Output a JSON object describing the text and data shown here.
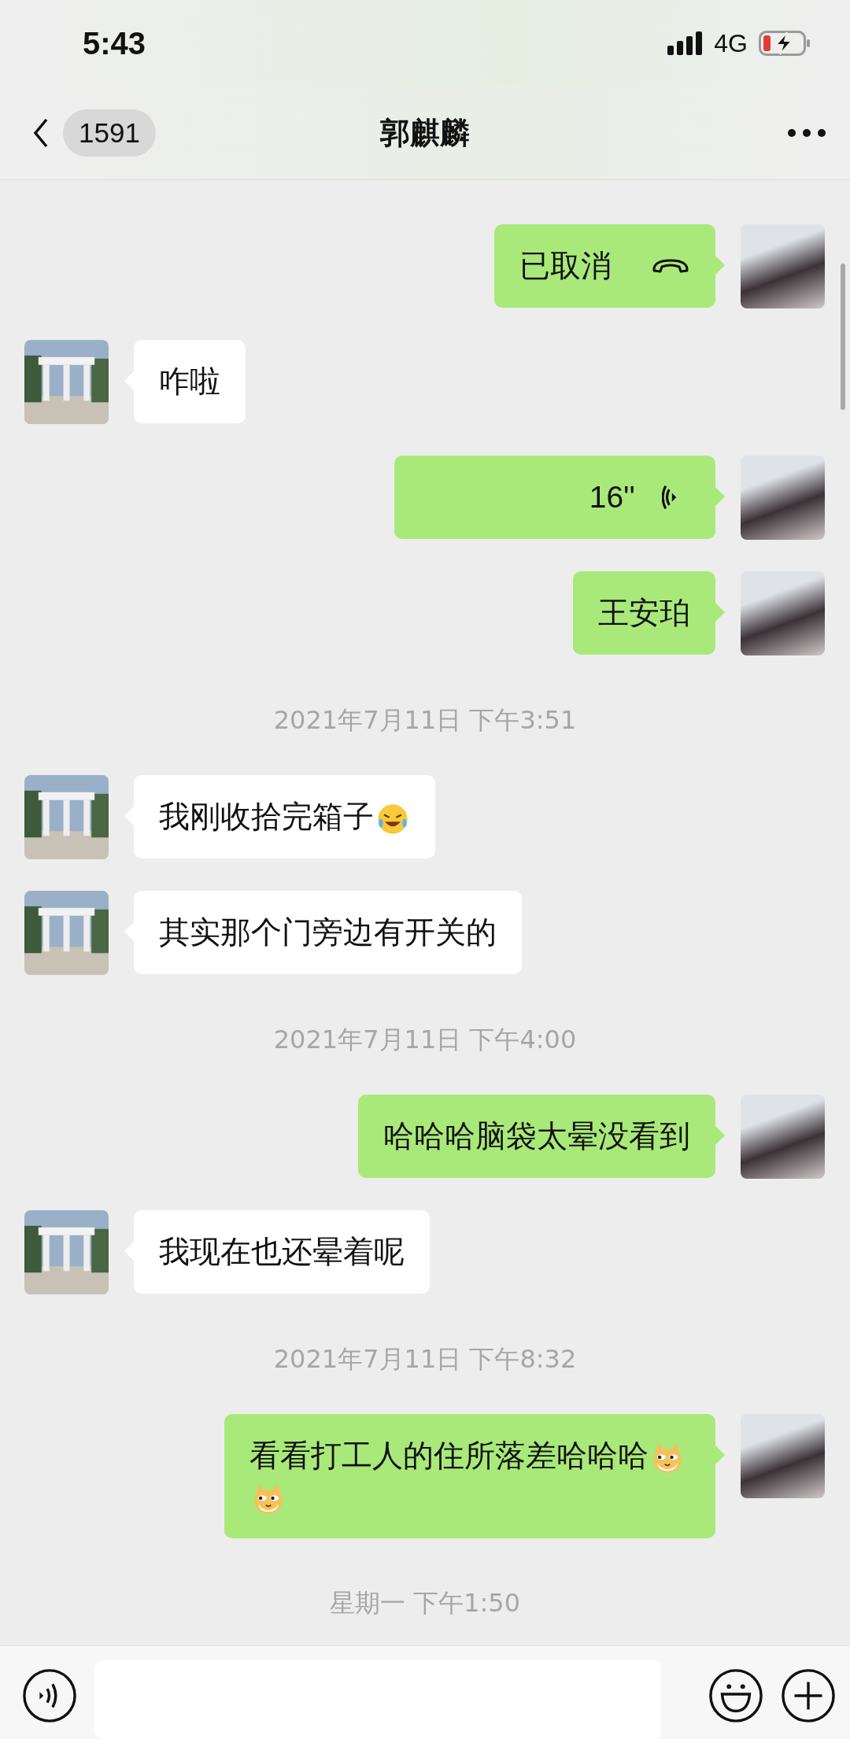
{
  "status_bar": {
    "time": "5:43",
    "network": "4G",
    "battery_low": true,
    "charging": true
  },
  "nav": {
    "unread": "1591",
    "title": "郭麒麟"
  },
  "messages": [
    {
      "kind": "call",
      "outgoing": true,
      "text": "已取消"
    },
    {
      "kind": "text",
      "outgoing": false,
      "text": "咋啦"
    },
    {
      "kind": "voice",
      "outgoing": true,
      "text": "16''"
    },
    {
      "kind": "text",
      "outgoing": true,
      "text": "王安珀"
    },
    {
      "kind": "timestamp",
      "text": "2021年7月11日 下午3:51"
    },
    {
      "kind": "text",
      "outgoing": false,
      "text": "我刚收拾完箱子",
      "emojis": [
        {
          "kind": "laugh-cry"
        }
      ]
    },
    {
      "kind": "text",
      "outgoing": false,
      "text": "其实那个门旁边有开关的"
    },
    {
      "kind": "timestamp",
      "text": "2021年7月11日 下午4:00"
    },
    {
      "kind": "text",
      "outgoing": true,
      "text": "哈哈哈脑袋太晕没看到"
    },
    {
      "kind": "text",
      "outgoing": false,
      "text": "我现在也还晕着呢"
    },
    {
      "kind": "timestamp",
      "text": "2021年7月11日 下午8:32"
    },
    {
      "kind": "text",
      "outgoing": true,
      "text": "看看打工人的住所落差哈哈哈",
      "emojis": [
        {
          "kind": "doge"
        },
        {
          "kind": "doge"
        }
      ]
    },
    {
      "kind": "timestamp",
      "text": "星期一 下午1:50"
    }
  ]
}
